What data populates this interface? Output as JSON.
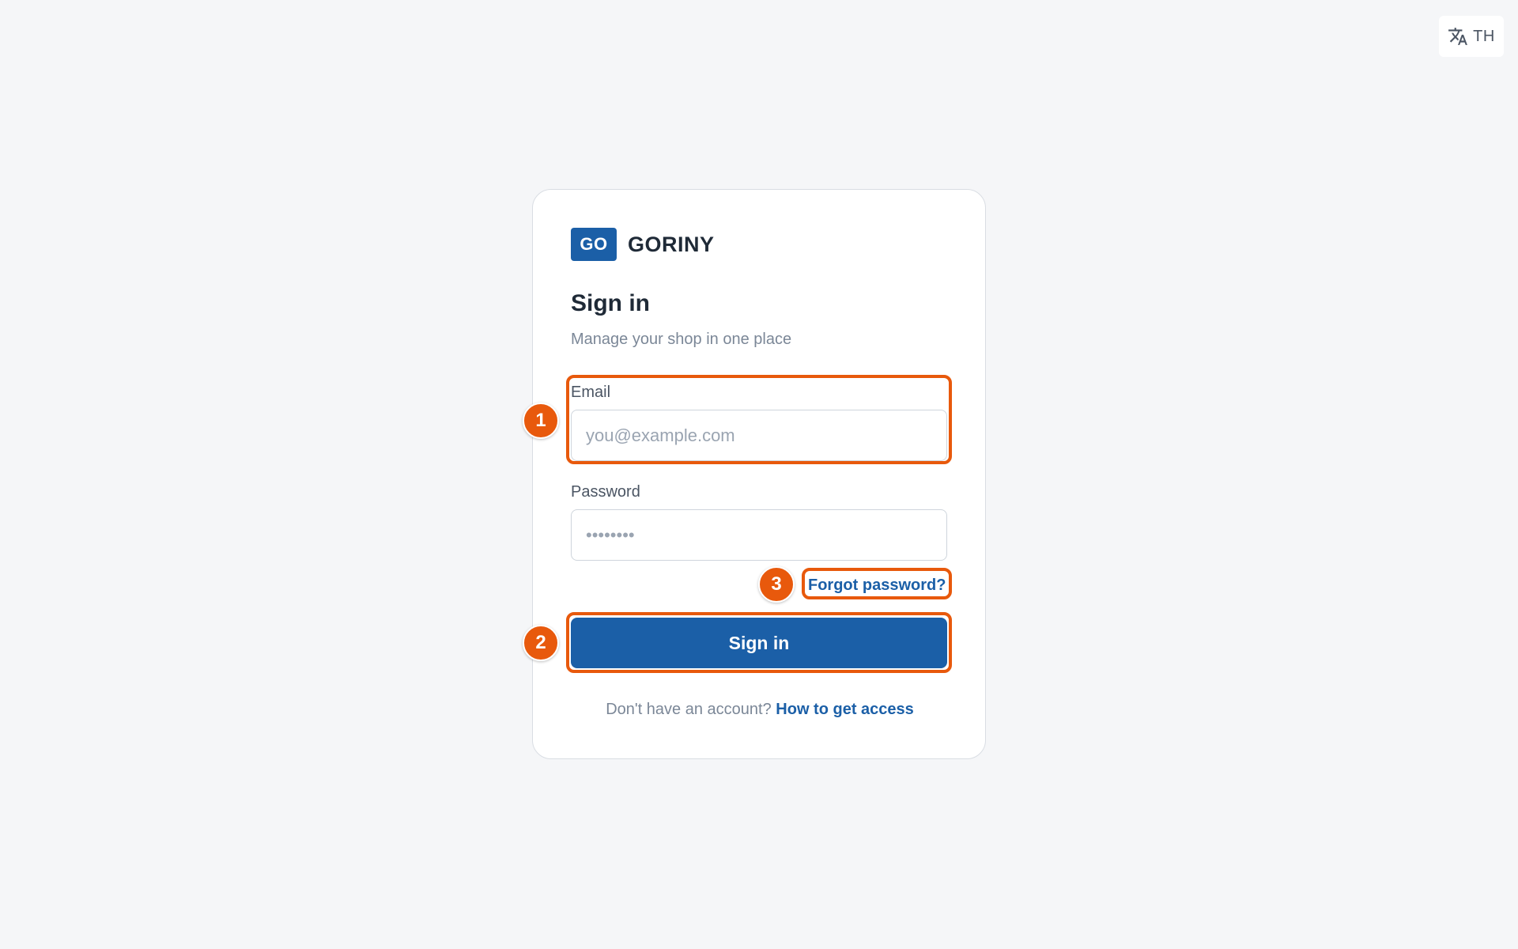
{
  "language_switch": {
    "icon": "translate-icon",
    "code": "TH"
  },
  "brand": {
    "logo_text": "GO",
    "name": "GORINY"
  },
  "form": {
    "title": "Sign in",
    "subtitle": "Manage your shop in one place",
    "email": {
      "label": "Email",
      "value": "",
      "placeholder": "you@example.com"
    },
    "password": {
      "label": "Password",
      "value": "",
      "placeholder": "••••••••"
    },
    "forgot_label": "Forgot password?",
    "submit_label": "Sign in",
    "footer_text": "Don't have an account?",
    "footer_link": "How to get access"
  },
  "annotations": {
    "badges": [
      "1",
      "2",
      "3"
    ],
    "color": "#e8590c"
  },
  "colors": {
    "brand_primary": "#1b5fa7",
    "background": "#f5f6f8",
    "annotation": "#e8590c"
  }
}
